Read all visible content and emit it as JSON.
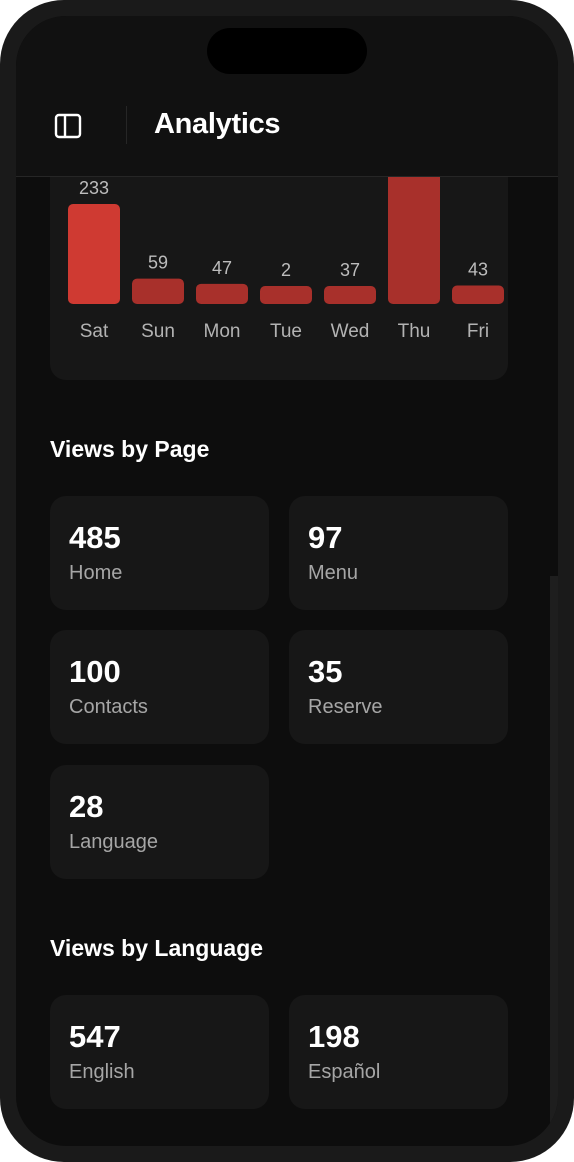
{
  "header": {
    "title": "Analytics",
    "sidebar_icon": "sidebar-toggle-icon"
  },
  "chart_data": {
    "type": "bar",
    "categories": [
      "Sat",
      "Sun",
      "Mon",
      "Tue",
      "Wed",
      "Thu",
      "Fri"
    ],
    "values": [
      233,
      59,
      47,
      2,
      37,
      null,
      43
    ],
    "value_labels": [
      "233",
      "59",
      "47",
      "2",
      "37",
      "",
      "43"
    ],
    "bar_colors": [
      "#cf3a32",
      "#a8302b",
      "#a8302b",
      "#a8302b",
      "#a8302b",
      "#a8302b",
      "#a8302b"
    ]
  },
  "views_by_page": {
    "title": "Views by Page",
    "items": [
      {
        "value": "485",
        "label": "Home"
      },
      {
        "value": "97",
        "label": "Menu"
      },
      {
        "value": "100",
        "label": "Contacts"
      },
      {
        "value": "35",
        "label": "Reserve"
      },
      {
        "value": "28",
        "label": "Language"
      }
    ]
  },
  "views_by_language": {
    "title": "Views by Language",
    "items": [
      {
        "value": "547",
        "label": "English"
      },
      {
        "value": "198",
        "label": "Español"
      }
    ]
  },
  "colors": {
    "background": "#0d0d0d",
    "card": "#171717",
    "accent": "#cf3a32",
    "bar": "#a8302b"
  }
}
